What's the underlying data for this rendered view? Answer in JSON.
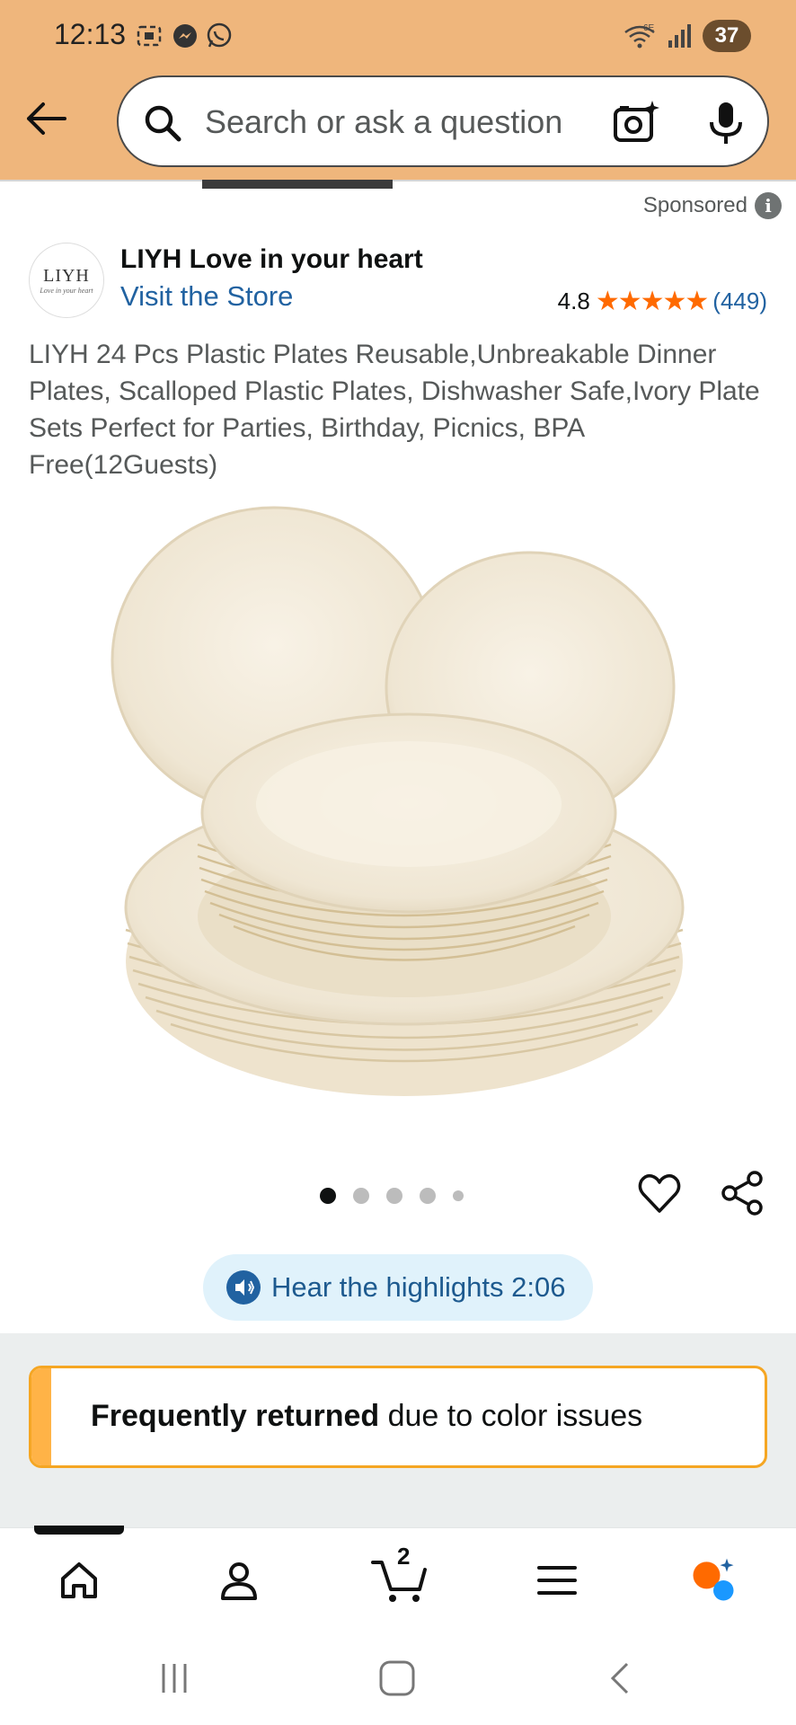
{
  "status_bar": {
    "time": "12:13",
    "battery": "37",
    "network": "6E"
  },
  "search": {
    "placeholder": "Search or ask a question"
  },
  "sponsored": {
    "label": "Sponsored",
    "info_glyph": "i"
  },
  "brand": {
    "logo_line1": "LIYH",
    "logo_line2": "Love in your heart",
    "name": "LIYH Love in your heart",
    "visit_store": "Visit the Store"
  },
  "rating": {
    "value": "4.8",
    "stars": "★★★★★",
    "count": "(449)"
  },
  "product": {
    "title": "LIYH 24 Pcs Plastic Plates Reusable,Unbreakable Dinner Plates, Scalloped Plastic Plates, Dishwasher Safe,Ivory Plate Sets Perfect for Parties, Birthday, Picnics, BPA Free(12Guests)"
  },
  "carousel": {
    "total": 5,
    "active_index": 0
  },
  "hear": {
    "label": "Hear the highlights 2:06"
  },
  "alert": {
    "bold": "Frequently returned",
    "rest": " due to color issues"
  },
  "bottom_nav": {
    "cart_count": "2"
  },
  "colors": {
    "header_bg": "#efb67c",
    "link": "#2162a1",
    "star": "#ff6a00",
    "alert_border": "#f5a623"
  }
}
